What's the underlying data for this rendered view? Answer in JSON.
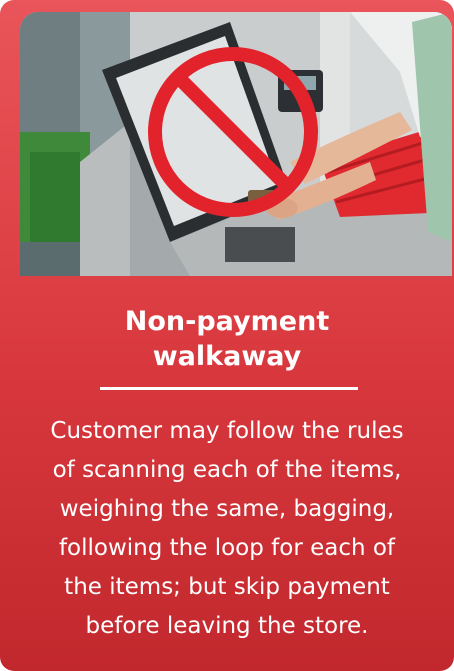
{
  "card": {
    "title_line1": "Non-payment",
    "title_line2": "walkaway",
    "description_lines": [
      "Customer may follow the rules",
      "of scanning each of the items,",
      "weighing the same, bagging,",
      "following the loop for each of",
      "the items; but skip payment",
      "before leaving the store."
    ],
    "image_icon": "prohibited-sign-icon",
    "colors": {
      "card_top": "#e9555a",
      "card_bottom": "#c1282d",
      "prohibited_red": "#e3232b",
      "text": "#ffffff"
    }
  }
}
